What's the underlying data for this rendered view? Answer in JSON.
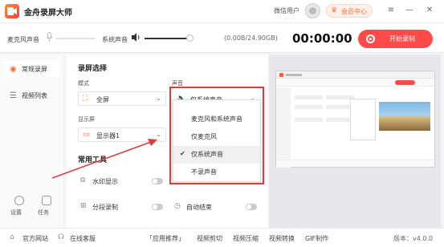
{
  "app": {
    "title": "金舟录屏大师",
    "wechat_user": "微信用户",
    "vip_label": "会员中心"
  },
  "controls": {
    "mic_label": "麦克风声音",
    "system_label": "系统声音",
    "size_text": "(0.00B/24.90GB)",
    "timer": "00:00:00",
    "record_label": "开始录制",
    "mic_level": 0,
    "system_level": 1.0
  },
  "sidebar": {
    "items": [
      {
        "label": "常规录屏",
        "icon": "record-icon",
        "active": true
      },
      {
        "label": "视频列表",
        "icon": "list-icon",
        "active": false
      }
    ],
    "settings_label": "设置",
    "tasks_label": "任务"
  },
  "record_select": {
    "section_title": "录屏选择",
    "mode_label": "模式",
    "mode_value": "全屏",
    "sound_label": "声音",
    "sound_value": "仅系统声音",
    "display_label": "显示屏",
    "display_value": "显示器1"
  },
  "sound_options": [
    {
      "label": "麦克风和系统声音",
      "checked": false
    },
    {
      "label": "仅麦克风",
      "checked": false
    },
    {
      "label": "仅系统声音",
      "checked": true
    },
    {
      "label": "不录声音",
      "checked": false
    }
  ],
  "tools": {
    "section_title": "常用工具",
    "items": [
      {
        "label": "水印显示",
        "on": false
      },
      {
        "label": "分段录制",
        "on": false
      },
      {
        "label": "自动结束",
        "on": false
      }
    ]
  },
  "statusbar": {
    "website": "官方网站",
    "support": "在线客服",
    "links": [
      "「应用推荐」",
      "视频剪切",
      "视频压缩",
      "视频转换",
      "GIF制作"
    ],
    "version": "版本：v4.0.0"
  },
  "colors": {
    "accent": "#ff4a4a",
    "highlight_box": "#e23a3a"
  }
}
